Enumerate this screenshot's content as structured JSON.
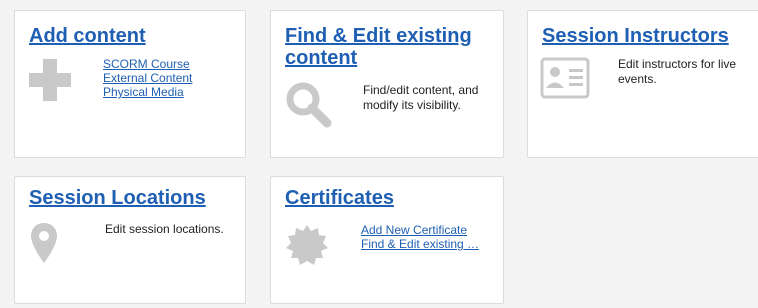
{
  "cards": {
    "add_content": {
      "title": "Add content",
      "links": [
        "SCORM Course",
        "External Content",
        "Physical Media"
      ]
    },
    "find_edit": {
      "title_line1": "Find & Edit existing",
      "title_line2": "content",
      "description": "Find/edit content, and modify its visibility."
    },
    "session_instructors": {
      "title": "Session Instructors",
      "description": "Edit instructors for live events."
    },
    "session_locations": {
      "title": "Session Locations",
      "description": "Edit session locations."
    },
    "certificates": {
      "title": "Certificates",
      "links": [
        "Add New Certificate",
        "Find & Edit existing …"
      ]
    }
  },
  "colors": {
    "link": "#1f5fb3",
    "icon": "#c9c9c9"
  },
  "icons": [
    "plus-icon",
    "magnifier-icon",
    "id-card-icon",
    "map-pin-icon",
    "badge-icon"
  ]
}
